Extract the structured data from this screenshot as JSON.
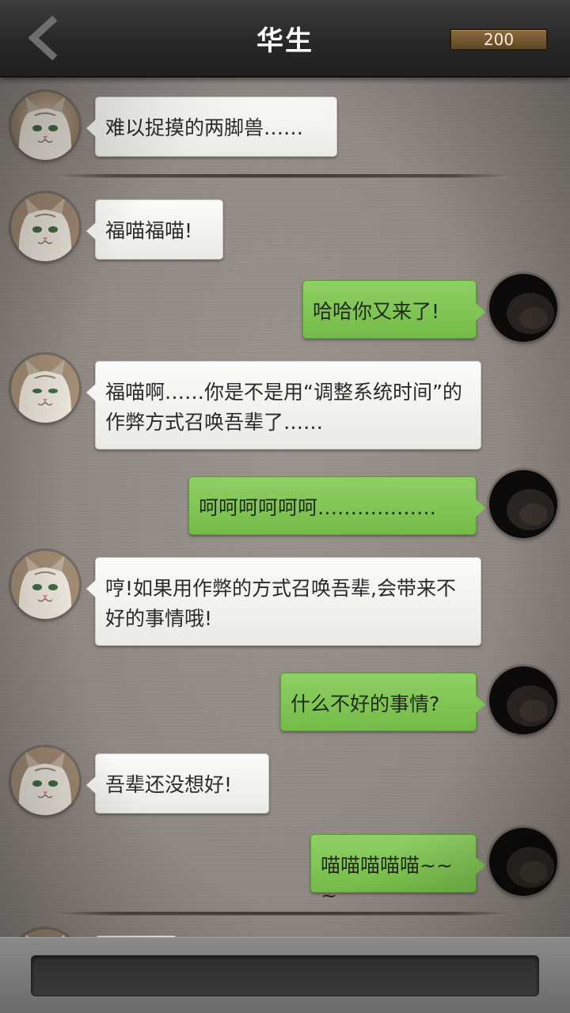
{
  "header": {
    "title": "华生",
    "coins": "200",
    "back_icon": "chevron-left-icon"
  },
  "messages": [
    {
      "side": "left",
      "text": "难以捉摸的两脚兽……"
    },
    {
      "side": "left",
      "text": "福喵福喵!"
    },
    {
      "side": "right",
      "text": "哈哈你又来了!"
    },
    {
      "side": "left",
      "text": "福喵啊……你是不是用“调整系统时间”的作弊方式召唤吾辈了……"
    },
    {
      "side": "right",
      "text": "呵呵呵呵呵呵………………"
    },
    {
      "side": "left",
      "text": "哼!如果用作弊的方式召唤吾辈,会带来不好的事情哦!"
    },
    {
      "side": "right",
      "text": "什么不好的事情?"
    },
    {
      "side": "left",
      "text": "吾辈还没想好!"
    },
    {
      "side": "right",
      "text": "喵喵喵喵喵~~~"
    }
  ],
  "footer": {
    "input_placeholder": ""
  },
  "colors": {
    "header_bg": "#262626",
    "left_bubble": "#f4f4f1",
    "right_bubble": "#80c555",
    "background": "#8f8781",
    "coin_box": "#6f5430"
  }
}
